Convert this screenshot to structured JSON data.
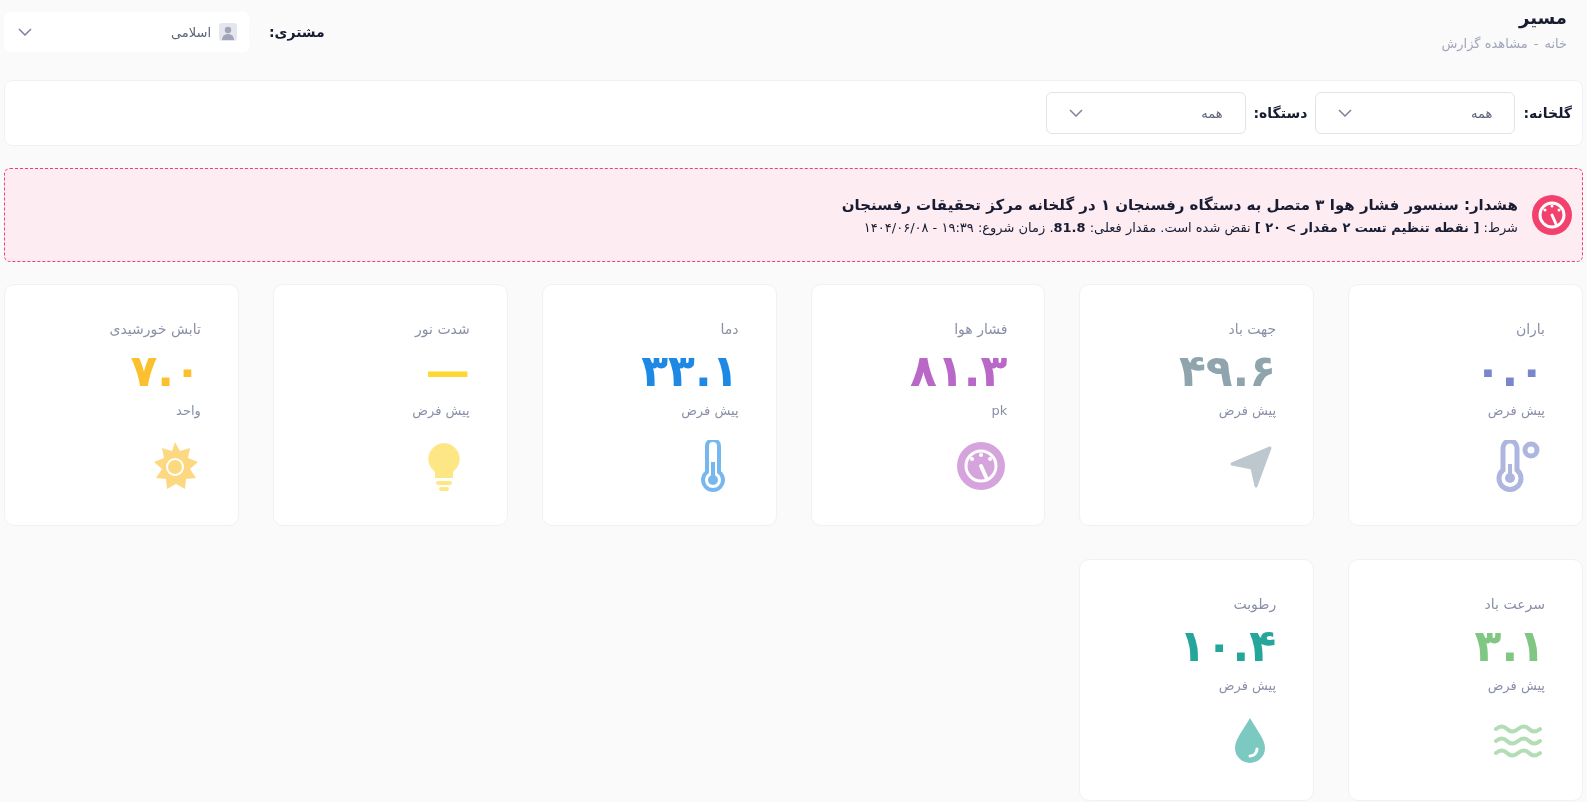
{
  "header": {
    "title": "مسیر",
    "breadcrumb": [
      "خانه",
      "مشاهده گزارش"
    ],
    "breadcrumb_separator": "-",
    "customer": {
      "label": "مشتری:",
      "value": "اسلامی"
    }
  },
  "filters": [
    {
      "label": "گلخانه:",
      "value": "همه"
    },
    {
      "label": "دستگاه:",
      "value": "همه"
    }
  ],
  "alert": {
    "title": "هشدار: سنسور فشار هوا ۳ متصل به دستگاه رفسنجان ۱ در گلخانه مرکز تحقیقات رفسنجان",
    "detail": "شرط: **[ نقطه تنظیم تست ۲ مقدار > ۲۰ ]** نقض شده است. مقدار فعلی: **81.8**. زمان شروع: ۱۹:۳۹ - ۱۴۰۴/۰۶/۰۸"
  },
  "sensors": [
    {
      "name": "باران",
      "value": "۰.۰",
      "unit": "پیش فرض",
      "color": "#7986cb"
    },
    {
      "name": "جهت باد",
      "value": "۴۹.۶",
      "unit": "پیش فرض",
      "color": "#90a4ae"
    },
    {
      "name": "فشار هوا",
      "value": "۸۱.۳",
      "unit": "pk",
      "color": "#ba68c8"
    },
    {
      "name": "دما",
      "value": "۳۳.۱",
      "unit": "پیش فرض",
      "color": "#1e88e5"
    },
    {
      "name": "شدت نور",
      "value": "—",
      "unit": "پیش فرض",
      "color": "#fdd835"
    },
    {
      "name": "تابش خورشیدی",
      "value": "۷.۰",
      "unit": "واحد",
      "color": "#fbc02d"
    },
    {
      "name": "سرعت باد",
      "value": "۳.۱",
      "unit": "پیش فرض",
      "color": "#81c784"
    },
    {
      "name": "رطوبت",
      "value": "۱۰.۴",
      "unit": "پیش فرض",
      "color": "#26a69a"
    }
  ]
}
